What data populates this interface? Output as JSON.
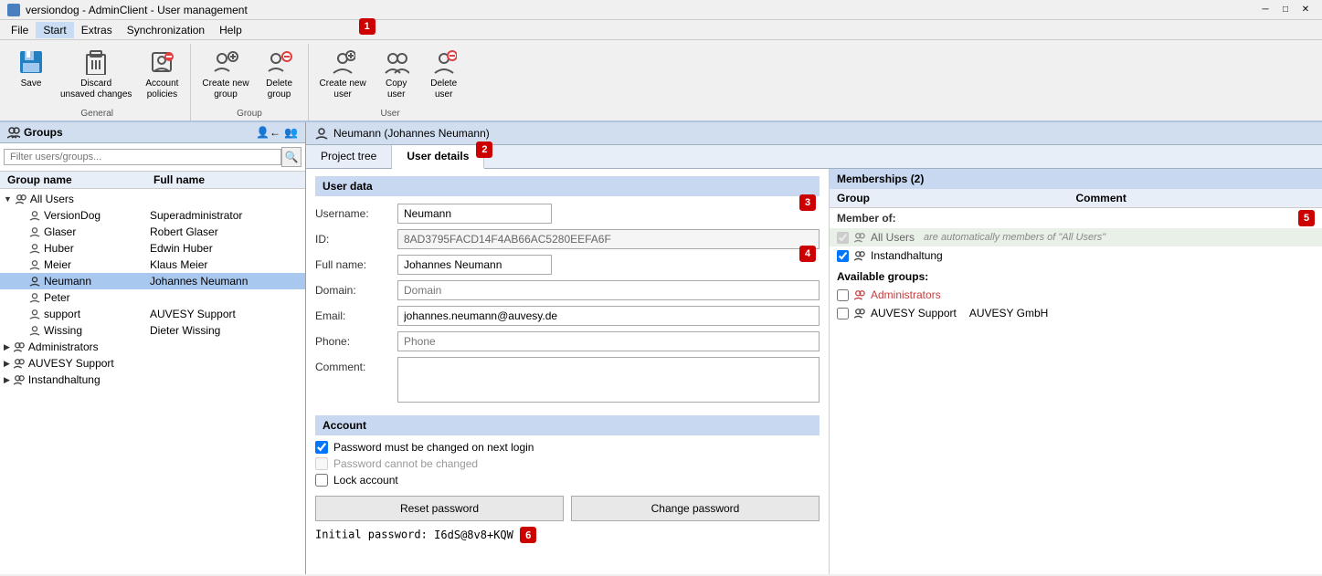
{
  "window": {
    "title": "versiondog - AdminClient - User management",
    "minimize": "─",
    "maximize": "□",
    "close": "✕"
  },
  "menubar": {
    "items": [
      "File",
      "Start",
      "Extras",
      "Synchronization",
      "Help"
    ],
    "active": 1
  },
  "ribbon": {
    "general_label": "General",
    "group_label": "Group",
    "user_label": "User",
    "buttons": {
      "save": "Save",
      "discard": "Discard\nunsaved changes",
      "account_policies": "Account\npolicies",
      "create_new_group": "Create new\ngroup",
      "delete_group": "Delete\ngroup",
      "create_new_user": "Create new\nuser",
      "copy_user": "Copy\nuser",
      "delete_user": "Delete\nuser"
    },
    "annotations": {
      "one": "1",
      "two": "2"
    }
  },
  "left_panel": {
    "title": "Groups",
    "filter_placeholder": "Filter users/groups...",
    "columns": [
      "Group name",
      "Full name"
    ],
    "all_users": "All Users",
    "users": [
      {
        "name": "VersionDog",
        "fullname": "Superadministrator",
        "indent": 2
      },
      {
        "name": "Glaser",
        "fullname": "Robert Glaser",
        "indent": 2
      },
      {
        "name": "Huber",
        "fullname": "Edwin Huber",
        "indent": 2
      },
      {
        "name": "Meier",
        "fullname": "Klaus Meier",
        "indent": 2
      },
      {
        "name": "Neumann",
        "fullname": "Johannes Neumann",
        "indent": 2,
        "selected": true
      },
      {
        "name": "Peter",
        "fullname": "",
        "indent": 2
      },
      {
        "name": "support",
        "fullname": "AUVESY Support",
        "indent": 2
      },
      {
        "name": "Wissing",
        "fullname": "Dieter Wissing",
        "indent": 2
      }
    ],
    "groups": [
      {
        "name": "Administrators",
        "indent": 1
      },
      {
        "name": "AUVESY Support",
        "indent": 1
      },
      {
        "name": "Instandhaltung",
        "indent": 1
      }
    ]
  },
  "right_panel": {
    "user_title": "Neumann (Johannes Neumann)",
    "tabs": [
      "Project tree",
      "User details"
    ],
    "active_tab": 1
  },
  "user_data": {
    "section_title": "User data",
    "username_label": "Username:",
    "username_value": "Neumann",
    "id_label": "ID:",
    "id_value": "8AD3795FACD14F4AB66AC5280EEFA6F",
    "fullname_label": "Full name:",
    "fullname_value": "Johannes Neumann",
    "domain_label": "Domain:",
    "domain_value": "",
    "domain_placeholder": "Domain",
    "email_label": "Email:",
    "email_value": "johannes.neumann@auvesy.de",
    "phone_label": "Phone:",
    "phone_value": "",
    "phone_placeholder": "Phone",
    "comment_label": "Comment:",
    "comment_value": ""
  },
  "account": {
    "section_title": "Account",
    "pwd_change_label": "Password must be changed on next login",
    "pwd_no_change_label": "Password cannot be changed",
    "lock_label": "Lock account",
    "reset_btn": "Reset password",
    "change_btn": "Change password",
    "initial_pwd_label": "Initial password:",
    "initial_pwd_value": "I6dS@8v8+KQW"
  },
  "memberships": {
    "section_title": "Memberships (2)",
    "col_group": "Group",
    "col_comment": "Comment",
    "member_of_label": "Member of:",
    "all_users_name": "All Users",
    "all_users_note": "are automatically members of \"All Users\"",
    "instandhaltung": "Instandhaltung",
    "available_label": "Available groups:",
    "available_groups": [
      {
        "name": "Administrators",
        "comment": ""
      },
      {
        "name": "AUVESY Support",
        "comment": "AUVESY GmbH"
      }
    ]
  },
  "annotations": {
    "1": "1",
    "2": "2",
    "3": "3",
    "4": "4",
    "5": "5",
    "6": "6"
  }
}
